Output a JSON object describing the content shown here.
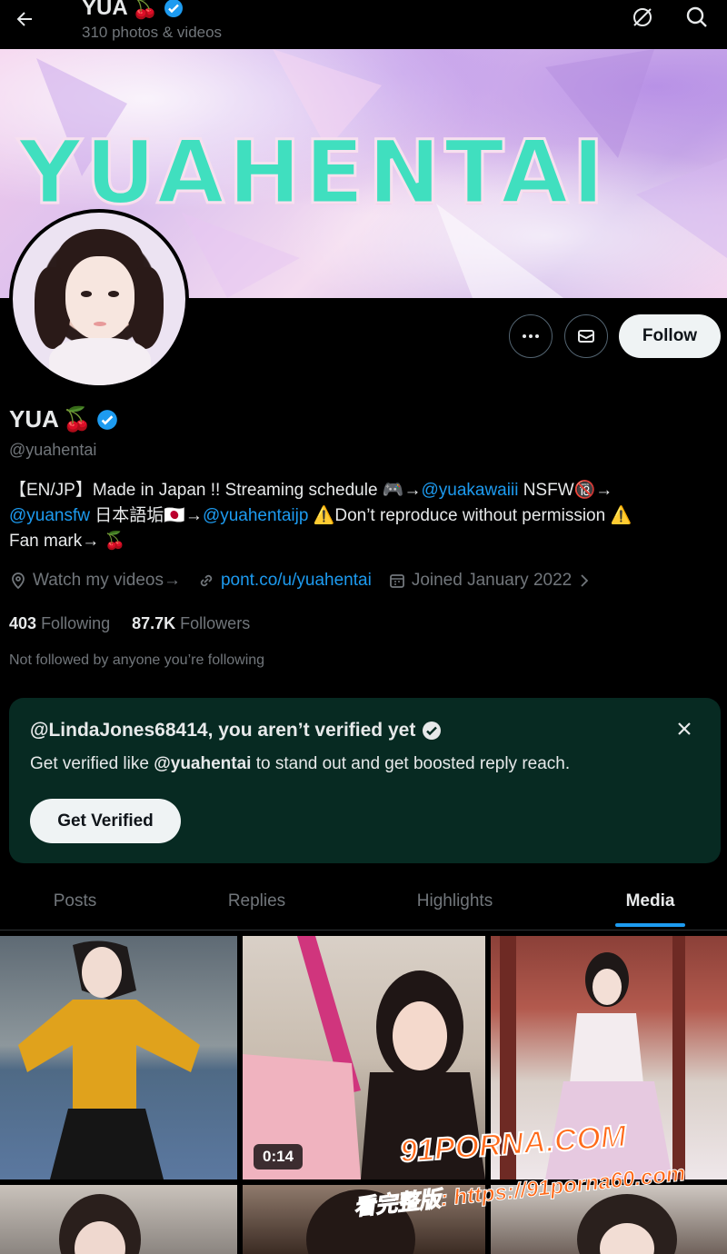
{
  "header": {
    "title": "YUA",
    "title_emoji": "🍒",
    "subtitle": "310 photos & videos"
  },
  "banner": {
    "text": "YUAHENTAI"
  },
  "profile": {
    "name": "YUA",
    "name_emoji": "🍒",
    "handle": "@yuahentai",
    "bio": {
      "p1": "【EN/JP】Made in Japan !! Streaming schedule 🎮→",
      "link1": "@yuakawaiii",
      "p2": " NSFW🔞→",
      "link2": "@yuansfw",
      "p3": " 日本語垢🇯🇵→",
      "link3": "@yuahentaijp",
      "p4": " ⚠️Don’t reproduce without permission ⚠️",
      "p5": "Fan mark→ 🍒"
    },
    "location": "Watch my videos→",
    "website": "pont.co/u/yuahentai",
    "joined": "Joined January 2022",
    "following_count": "403",
    "following_label": "Following",
    "followers_count": "87.7K",
    "followers_label": "Followers",
    "not_followed": "Not followed by anyone you’re following"
  },
  "actions": {
    "follow_label": "Follow"
  },
  "verify_card": {
    "title": "@LindaJones68414, you aren’t verified yet",
    "desc_pre": "Get verified like ",
    "desc_handle": "@yuahentai",
    "desc_post": " to stand out and get boosted reply reach.",
    "button": "Get Verified"
  },
  "tabs": [
    {
      "label": "Posts"
    },
    {
      "label": "Replies"
    },
    {
      "label": "Highlights"
    },
    {
      "label": "Media"
    }
  ],
  "media": {
    "video_duration": "0:14"
  },
  "watermark": {
    "line1": "91PORNA.COM",
    "line2": "看完整版: https://91porna60.com"
  },
  "colors": {
    "accent": "#1d9bf0",
    "verified": "#1d9bf0",
    "card_bg": "#072a22",
    "banner_text": "#40dfbf"
  }
}
